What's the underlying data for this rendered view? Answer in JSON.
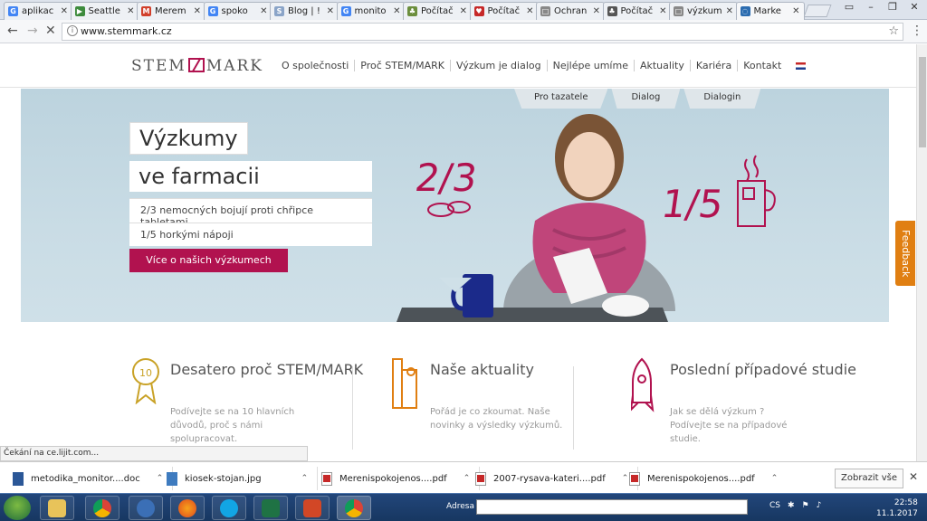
{
  "browser": {
    "tabs": [
      {
        "label": "aplikac",
        "color": "#4285f4",
        "glyph": "G"
      },
      {
        "label": "Seattle",
        "color": "#3d8b3d",
        "glyph": "▶"
      },
      {
        "label": "Merem",
        "color": "#d13f2b",
        "glyph": "M"
      },
      {
        "label": "spoko",
        "color": "#4285f4",
        "glyph": "G"
      },
      {
        "label": "Blog | !",
        "color": "#8aa4c8",
        "glyph": "S"
      },
      {
        "label": "monito",
        "color": "#4285f4",
        "glyph": "G"
      },
      {
        "label": "Počítač",
        "color": "#6b8e3d",
        "glyph": "♣"
      },
      {
        "label": "Počítač",
        "color": "#c62828",
        "glyph": "♥"
      },
      {
        "label": "Ochran",
        "color": "#888888",
        "glyph": "□"
      },
      {
        "label": "Počítač",
        "color": "#555555",
        "glyph": "♣"
      },
      {
        "label": "výzkum",
        "color": "#888888",
        "glyph": "□"
      },
      {
        "label": "Marke",
        "color": "#2b6cb0",
        "glyph": "◌"
      }
    ],
    "url": "www.stemmark.cz",
    "info_icon": "i"
  },
  "site": {
    "logo_left": "STEM",
    "logo_right": "MARK",
    "nav": [
      "O společnosti",
      "Proč STEM/MARK",
      "Výzkum je dialog",
      "Nejlépe umíme",
      "Aktuality",
      "Kariéra",
      "Kontakt"
    ],
    "subtabs": [
      "Pro tazatele",
      "Dialog",
      "Dialogin"
    ],
    "hero": {
      "title_line1": "Výzkumy",
      "title_line2": "ve farmacii",
      "fact1": "2/3 nemocných bojují proti chřipce tabletami",
      "fact2": "1/5 horkými nápoji",
      "cta": "Více o našich výzkumech",
      "frac1": "2/3",
      "frac2": "1/5"
    },
    "features": [
      {
        "title": "Desatero proč STEM/MARK",
        "desc": "Podívejte se na 10 hlavních důvodů, proč s námi spolupracovat."
      },
      {
        "title": "Naše aktuality",
        "desc": "Pořád je co zkoumat. Naše novinky a výsledky výzkumů."
      },
      {
        "title": "Poslední případové studie",
        "desc": "Jak se dělá výzkum ? Podívejte se na případové studie."
      }
    ],
    "feedback": "Feedback",
    "badge10": "10"
  },
  "status_text": "Čekání na ce.lijit.com...",
  "downloads": [
    {
      "name": "metodika_monitor....doc",
      "type": "doc"
    },
    {
      "name": "kiosek-stojan.jpg",
      "type": "img"
    },
    {
      "name": "Merenispokojenos....pdf",
      "type": "pdf"
    },
    {
      "name": "2007-rysava-kateri....pdf",
      "type": "pdf"
    },
    {
      "name": "Merenispokojenos....pdf",
      "type": "pdf"
    }
  ],
  "show_all": "Zobrazit vše",
  "taskbar": {
    "address_label": "Adresa",
    "lang": "CS",
    "time": "22:58",
    "date": "11.1.2017"
  }
}
